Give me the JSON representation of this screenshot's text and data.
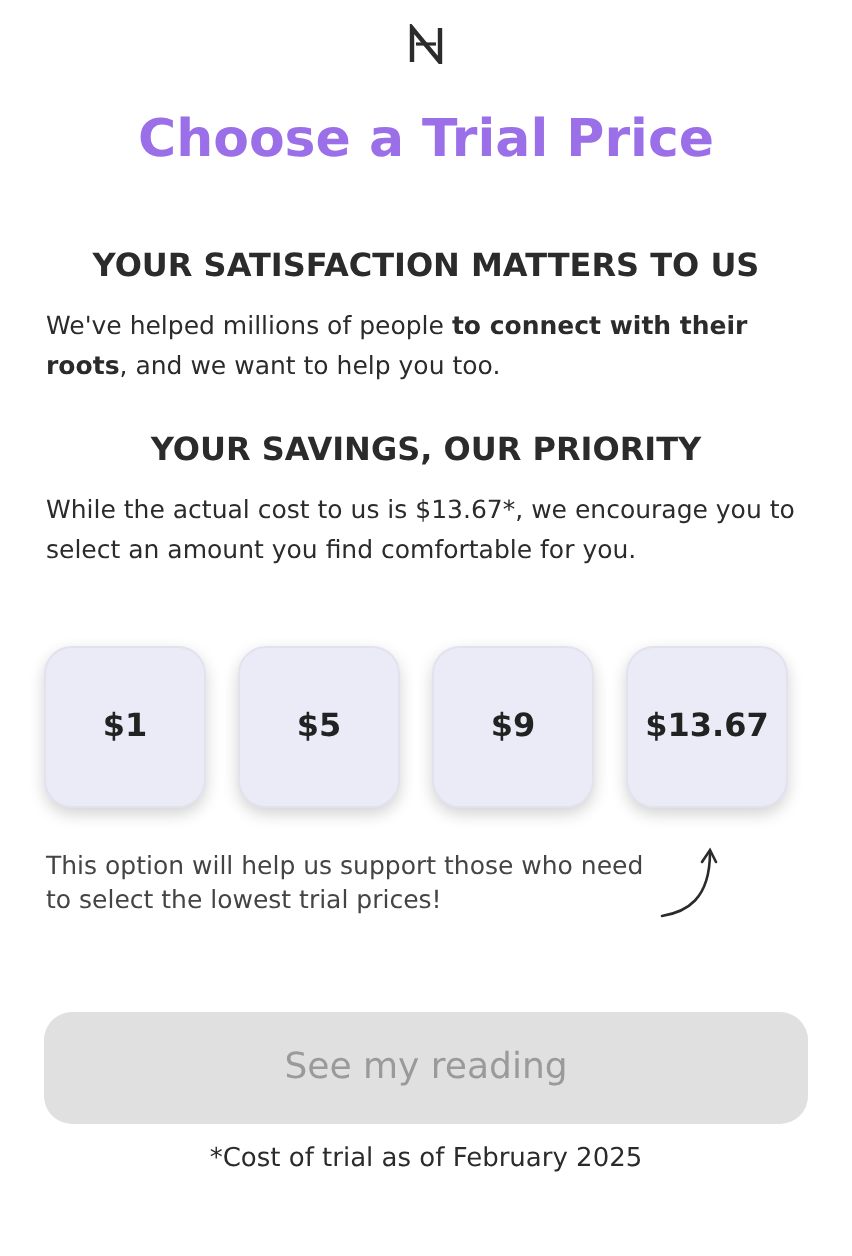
{
  "title": "Choose a Trial Price",
  "sections": [
    {
      "heading": "YOUR SATISFACTION MATTERS TO US",
      "text": "We've helped millions of people **to connect with their roots**, and we want to help you too."
    },
    {
      "heading": "YOUR SAVINGS, OUR PRIORITY",
      "text": "While the actual cost to us is $13.67*, we encourage you to select an amount you find comfortable for you."
    }
  ],
  "prices": [
    {
      "label": "$1",
      "selected": false
    },
    {
      "label": "$5",
      "selected": false
    },
    {
      "label": "$9",
      "selected": false
    },
    {
      "label": "$13.67",
      "selected": false
    }
  ],
  "note": "This option will help us support those who need to select the lowest trial prices!",
  "button": {
    "label": "See my reading",
    "disabled": true
  },
  "footnote": "*Cost of trial as of February 2025"
}
